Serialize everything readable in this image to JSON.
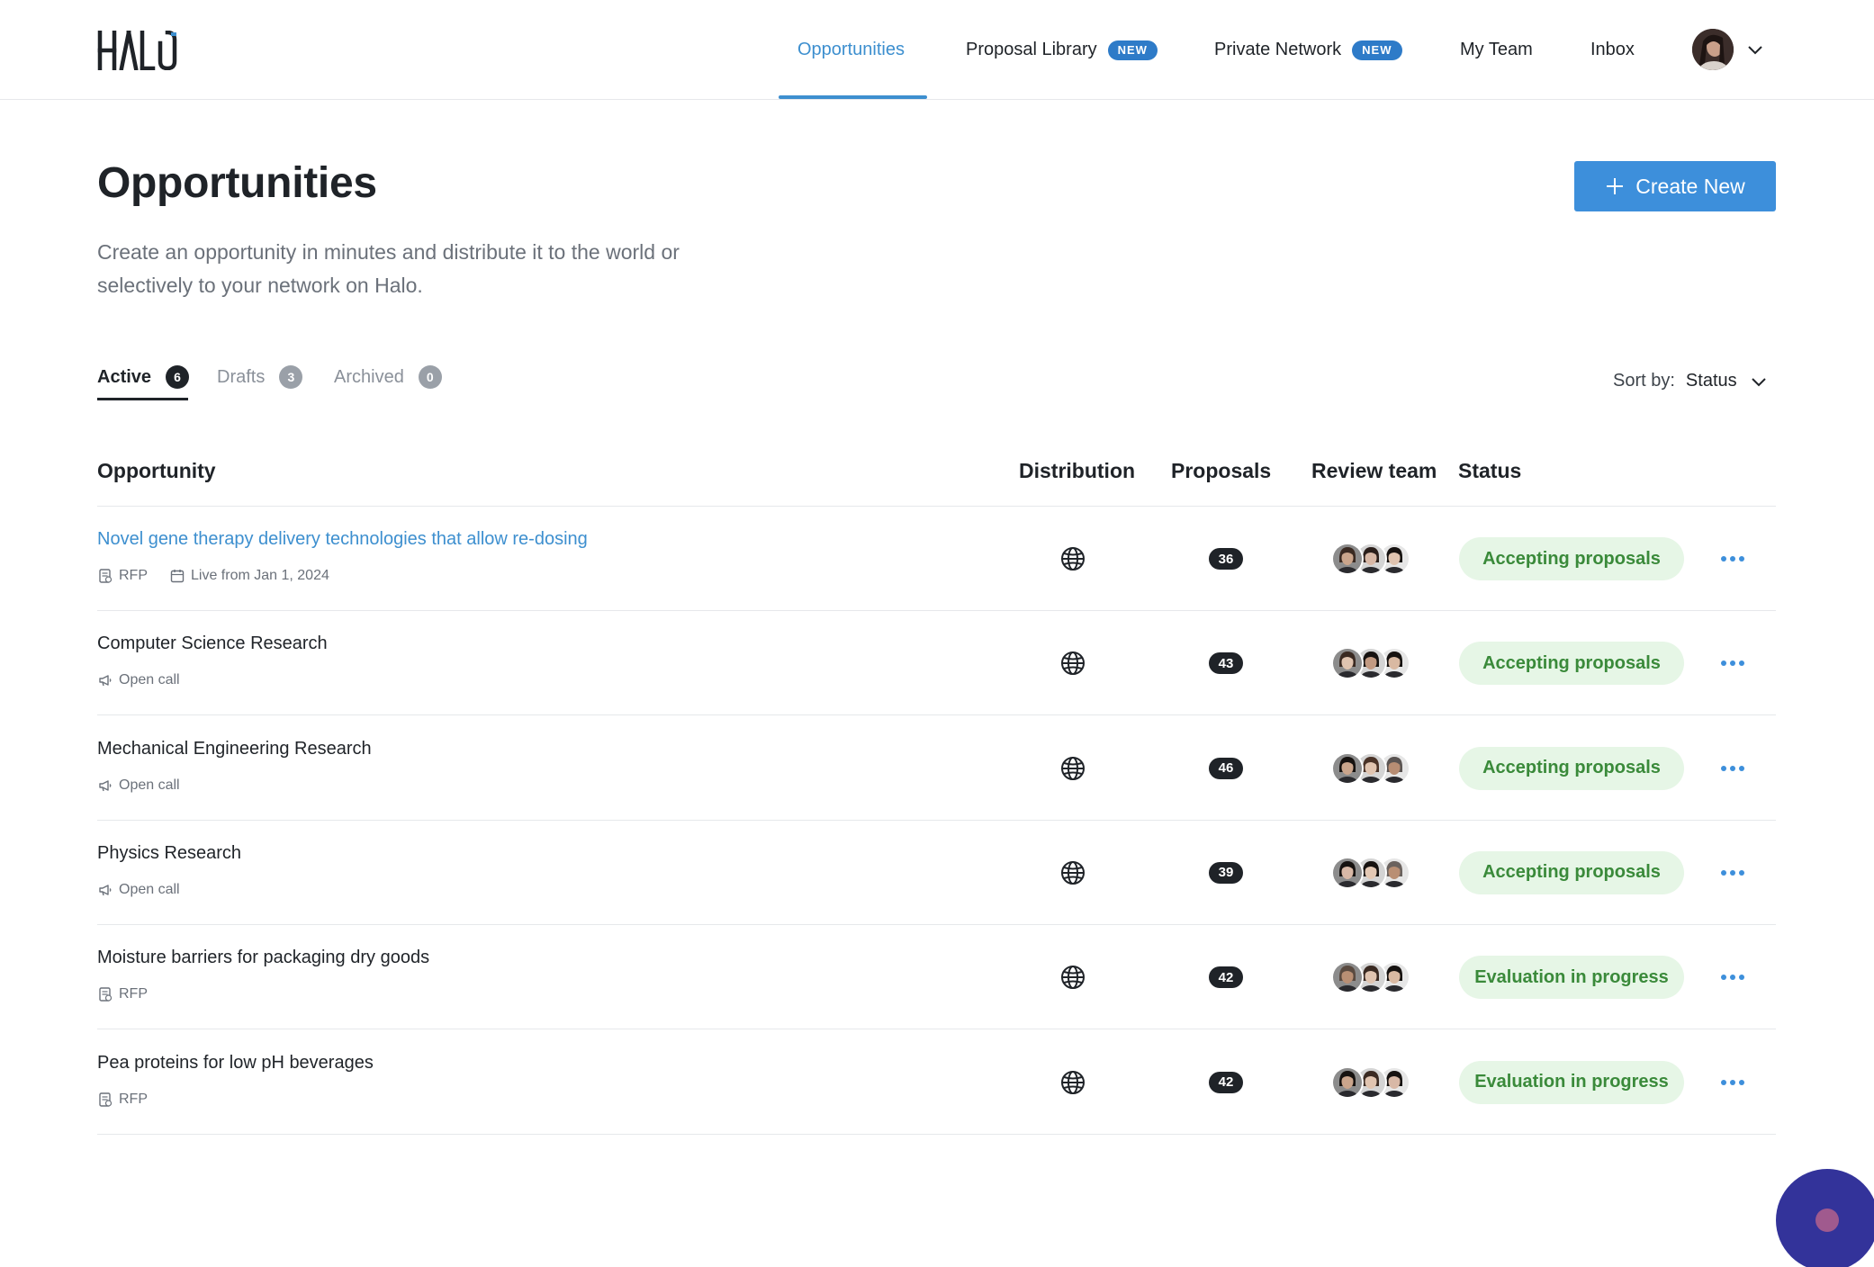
{
  "brand": {
    "logo_text": "HALO",
    "accent_color": "#3d8fcf"
  },
  "nav": {
    "items": [
      {
        "label": "Opportunities",
        "active": true
      },
      {
        "label": "Proposal Library",
        "badge": "NEW"
      },
      {
        "label": "Private Network",
        "badge": "NEW"
      },
      {
        "label": "My Team"
      },
      {
        "label": "Inbox"
      }
    ]
  },
  "page": {
    "title": "Opportunities",
    "description": "Create an opportunity in minutes and distribute it to the world or selectively to your network on Halo.",
    "create_button": "Create New"
  },
  "tabs": [
    {
      "label": "Active",
      "count": "6",
      "active": true
    },
    {
      "label": "Drafts",
      "count": "3"
    },
    {
      "label": "Archived",
      "count": "0"
    }
  ],
  "sort": {
    "label": "Sort by:",
    "value": "Status"
  },
  "table": {
    "columns": [
      "Opportunity",
      "Distribution",
      "Proposals",
      "Review team",
      "Status"
    ],
    "rows": [
      {
        "title": "Novel gene therapy delivery technologies that allow re-dosing",
        "type": "RFP",
        "type_icon": "rfp-icon",
        "live": "Live from Jan 1, 2024",
        "distribution": "globe-icon",
        "proposals": "36",
        "status": "Accepting proposals"
      },
      {
        "title": "Computer Science Research",
        "type": "Open call",
        "type_icon": "megaphone-icon",
        "distribution": "globe-icon",
        "proposals": "43",
        "status": "Accepting proposals"
      },
      {
        "title": "Mechanical Engineering Research",
        "type": "Open call",
        "type_icon": "megaphone-icon",
        "distribution": "globe-icon",
        "proposals": "46",
        "status": "Accepting proposals"
      },
      {
        "title": "Physics Research",
        "type": "Open call",
        "type_icon": "megaphone-icon",
        "distribution": "globe-icon",
        "proposals": "39",
        "status": "Accepting proposals"
      },
      {
        "title": "Moisture barriers for packaging dry goods",
        "type": "RFP",
        "type_icon": "rfp-icon",
        "distribution": "globe-icon",
        "proposals": "42",
        "status": "Evaluation in progress"
      },
      {
        "title": "Pea proteins for low pH beverages",
        "type": "RFP",
        "type_icon": "rfp-icon",
        "distribution": "globe-icon",
        "proposals": "42",
        "status": "Evaluation in progress"
      }
    ]
  },
  "colors": {
    "primary_button": "#3d8fdb",
    "status_pill_bg": "#e6f6e6",
    "status_pill_text": "#3a8a3a",
    "new_badge": "#2e7bc8",
    "chat_bubble": "#33339a"
  }
}
